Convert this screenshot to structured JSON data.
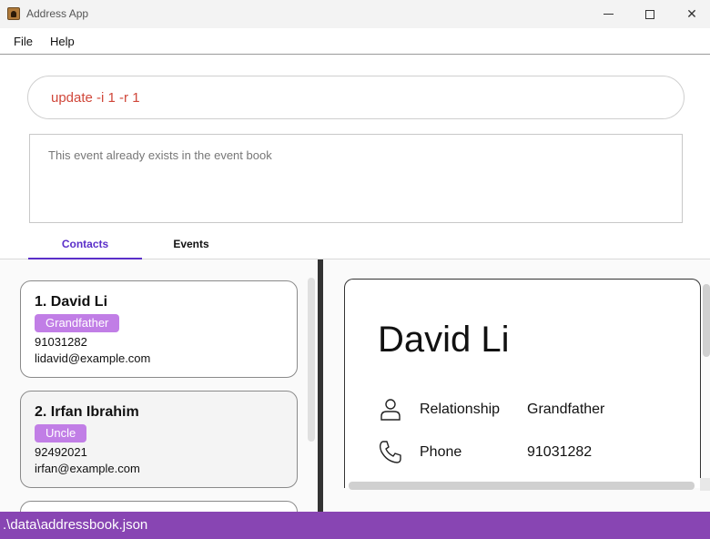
{
  "window": {
    "title": "Address App"
  },
  "menu": {
    "file": "File",
    "help": "Help"
  },
  "command": {
    "value": "update -i 1 -r 1"
  },
  "result": {
    "message": "This event already exists in the event book"
  },
  "tabs": [
    {
      "label": "Contacts",
      "active": true
    },
    {
      "label": "Events",
      "active": false
    }
  ],
  "contacts": [
    {
      "name": "1. David Li",
      "tag": "Grandfather",
      "phone": "91031282",
      "email": "lidavid@example.com"
    },
    {
      "name": "2. Irfan Ibrahim",
      "tag": "Uncle",
      "phone": "92492021",
      "email": "irfan@example.com"
    }
  ],
  "detail": {
    "name": "David Li",
    "fields": [
      {
        "icon": "person-icon",
        "label": "Relationship",
        "value": "Grandfather"
      },
      {
        "icon": "phone-icon",
        "label": "Phone",
        "value": "91031282"
      }
    ]
  },
  "status": {
    "path": ".\\data\\addressbook.json"
  },
  "colors": {
    "accent": "#5b2fc9",
    "tag": "#c17ee6",
    "statusbar": "#8845b3",
    "command_text": "#d0473a"
  }
}
